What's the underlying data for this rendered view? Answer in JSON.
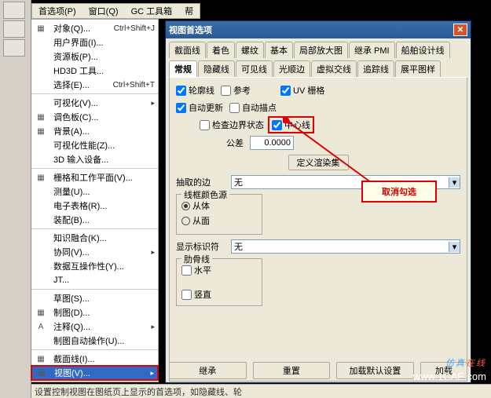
{
  "menubar": {
    "items": [
      "首选项(P)",
      "窗口(Q)",
      "GC 工具箱",
      "帮"
    ]
  },
  "dropdown": {
    "sections": [
      [
        {
          "label": "对象(Q)...",
          "accel": "Ctrl+Shift+J",
          "icon": "▦"
        },
        {
          "label": "用户界面(I)...",
          "icon": ""
        },
        {
          "label": "资源板(P)...",
          "icon": ""
        },
        {
          "label": "HD3D 工具...",
          "icon": ""
        },
        {
          "label": "选择(E)...",
          "accel": "Ctrl+Shift+T",
          "icon": ""
        }
      ],
      [
        {
          "label": "可视化(V)...",
          "arrow": true,
          "icon": ""
        },
        {
          "label": "调色板(C)...",
          "icon": "▦"
        },
        {
          "label": "背景(A)...",
          "icon": "▦"
        },
        {
          "label": "可视化性能(Z)...",
          "icon": ""
        },
        {
          "label": "3D 输入设备...",
          "icon": ""
        }
      ],
      [
        {
          "label": "栅格和工作平面(V)...",
          "icon": "▦"
        },
        {
          "label": "测量(U)...",
          "icon": ""
        },
        {
          "label": "电子表格(R)...",
          "icon": ""
        },
        {
          "label": "装配(B)...",
          "icon": ""
        }
      ],
      [
        {
          "label": "知识融合(K)...",
          "icon": ""
        },
        {
          "label": "协同(V)...",
          "arrow": true,
          "icon": ""
        },
        {
          "label": "数据互操作性(Y)...",
          "icon": ""
        },
        {
          "label": "JT...",
          "icon": ""
        }
      ],
      [
        {
          "label": "草图(S)...",
          "icon": ""
        },
        {
          "label": "制图(D)...",
          "icon": "▦"
        },
        {
          "label": "注释(Q)...",
          "arrow": true,
          "icon": "A"
        },
        {
          "label": "制图自动操作(U)...",
          "icon": ""
        }
      ],
      [
        {
          "label": "截面线(I)...",
          "icon": "▦"
        },
        {
          "label": "视图(V)...",
          "arrow": true,
          "icon": "▦",
          "red": true,
          "sel": true
        }
      ]
    ]
  },
  "dialog": {
    "title": "视图首选项",
    "tabs_row1": [
      "截面线",
      "着色",
      "螺纹",
      "基本",
      "局部放大图",
      "继承 PMI",
      "船舶设计线"
    ],
    "tabs_row2": [
      "常规",
      "隐藏线",
      "可见线",
      "光顺边",
      "虚拟交线",
      "追踪线",
      "展平图样"
    ],
    "active_tab": "常规",
    "chk": {
      "lunkuo": "轮廓线",
      "cankao": "参考",
      "uv": "UV 栅格",
      "zidonggengxin": "自动更新",
      "zidongmaodian": "自动描点",
      "jiancha": "检查边界状态",
      "zhongxin": "中心线"
    },
    "tol_label": "公差",
    "tol_value": "0.0000",
    "btn_define": "定义渲染集",
    "extract_label": "抽取的边",
    "extract_value": "无",
    "group_wire": "线框颜色源",
    "radio_body": "从体",
    "radio_face": "从面",
    "display_label": "显示标识符",
    "display_value": "无",
    "group_rib": "肋骨线",
    "chk_h": "水平",
    "chk_v": "竖直",
    "buttons": [
      "继承",
      "重置",
      "加载默认设置",
      "加载"
    ]
  },
  "annot": {
    "text": "取消勾选"
  },
  "status": "设置控制视图在图纸页上显示的首选项，如隐藏线、轮",
  "watermark": {
    "cn_b": "仿真",
    "cn_r": "在线",
    "url": "www.1CAE.com"
  }
}
